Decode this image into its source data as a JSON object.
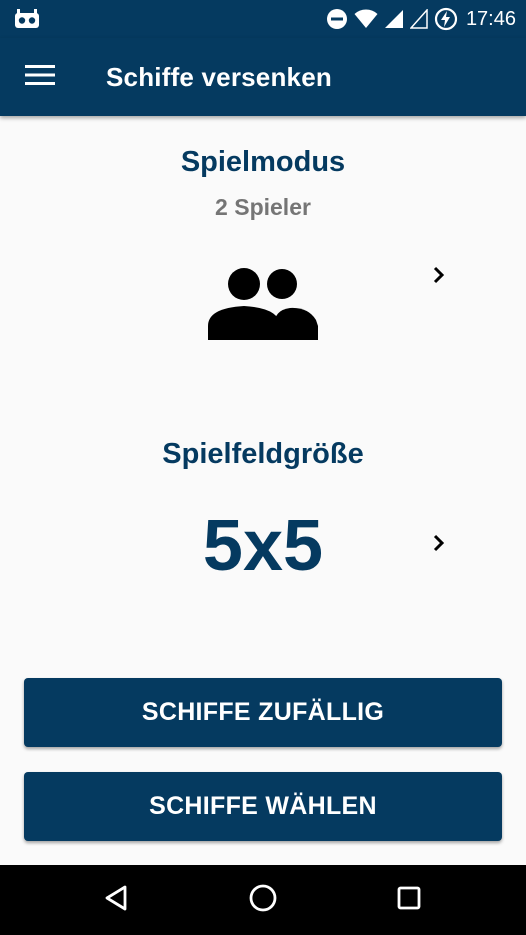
{
  "status_bar": {
    "time": "17:46",
    "icons": [
      "notification-app-icon",
      "do-not-disturb-icon",
      "wifi-icon",
      "cell-signal-icon",
      "battery-charging-icon"
    ]
  },
  "app_bar": {
    "title": "Schiffe versenken",
    "menu_icon": "hamburger-menu-icon"
  },
  "game_mode": {
    "title": "Spielmodus",
    "value": "2 Spieler",
    "icon": "two-people-icon",
    "next_icon": "chevron-right-icon"
  },
  "field_size": {
    "title": "Spielfeldgröße",
    "value": "5x5",
    "next_icon": "chevron-right-icon"
  },
  "buttons": {
    "random_label": "SCHIFFE ZUFÄLLIG",
    "choose_label": "SCHIFFE WÄHLEN"
  },
  "nav_bar": {
    "icons": [
      "back-icon",
      "home-icon",
      "recent-apps-icon"
    ]
  },
  "colors": {
    "primary": "#053a60",
    "secondary_text": "#757575",
    "background": "#fafafa"
  }
}
